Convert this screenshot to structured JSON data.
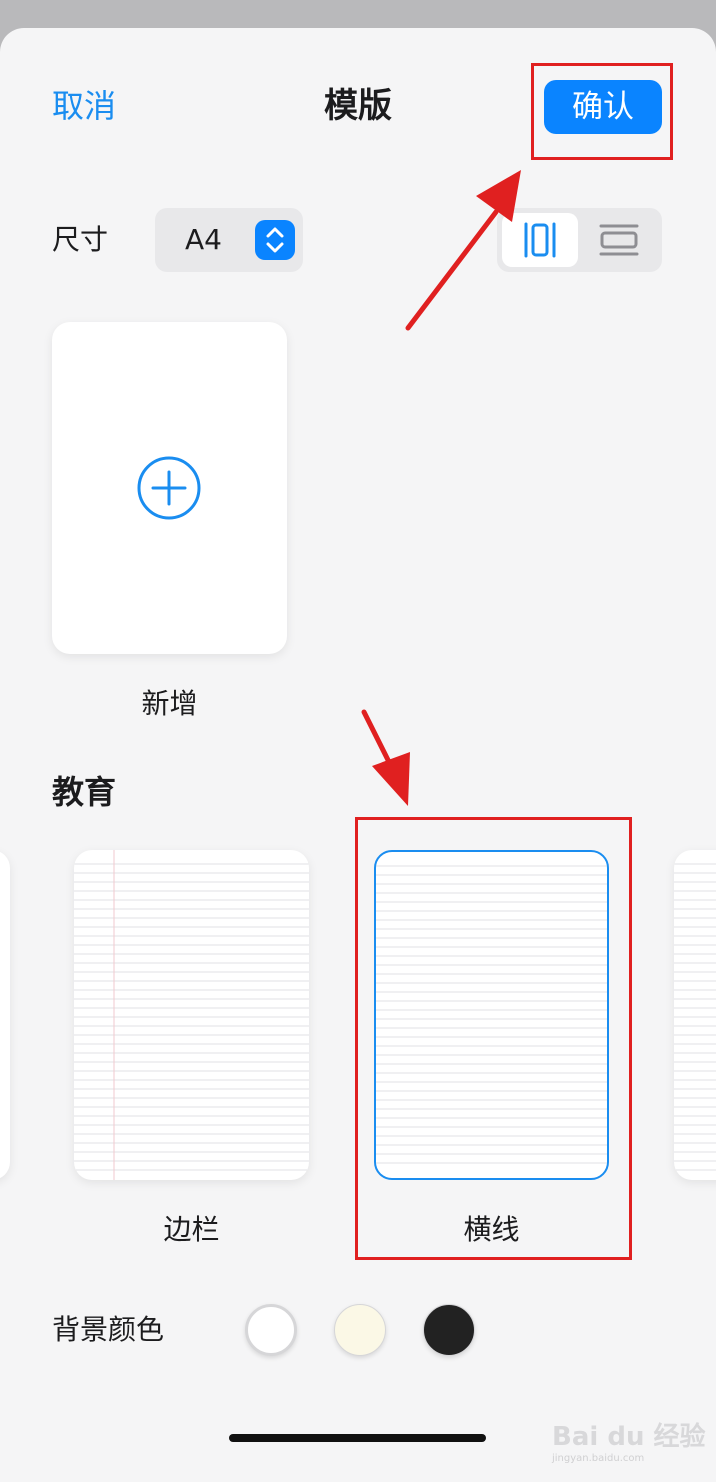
{
  "header": {
    "cancel_label": "取消",
    "title": "模版",
    "confirm_label": "确认"
  },
  "size": {
    "label": "尺寸",
    "value": "A4",
    "orientation_selected": "portrait",
    "orientation_icons": [
      "portrait-orientation-icon",
      "landscape-orientation-icon"
    ]
  },
  "add_template": {
    "label": "新增",
    "icon": "plus-circle-icon"
  },
  "section": {
    "title": "教育",
    "templates": [
      {
        "label": "边栏",
        "selected": false
      },
      {
        "label": "横线",
        "selected": true
      }
    ]
  },
  "background_color": {
    "label": "背景颜色",
    "options": [
      "#ffffff",
      "#fbf8e6",
      "#222222"
    ]
  },
  "watermark": {
    "text": "Bai du 经验",
    "sub": "jingyan.baidu.com"
  },
  "colors": {
    "accent": "#0a84ff",
    "annotation": "#e02020"
  }
}
